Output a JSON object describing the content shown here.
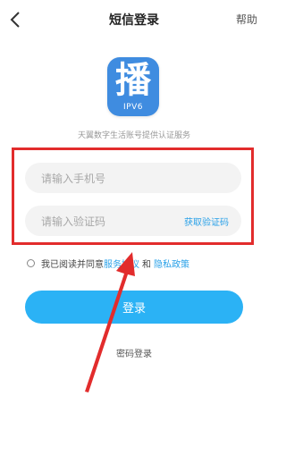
{
  "header": {
    "back_icon": "chevron-left-icon",
    "title": "短信登录",
    "help_label": "帮助"
  },
  "logo": {
    "glyph": "播",
    "tag": "IPV6",
    "color": "#3f8ce0"
  },
  "subtitle": "天翼数字生活账号提供认证服务",
  "form": {
    "phone_placeholder": "请输入手机号",
    "code_placeholder": "请输入验证码",
    "get_code_label": "获取验证码"
  },
  "agreement": {
    "prefix": "我已阅读并同意",
    "service_link": "服务协议",
    "and": "和",
    "privacy_link": "隐私政策"
  },
  "login_button": "登录",
  "password_login": "密码登录",
  "annotation": {
    "highlight_color": "#e22c2c",
    "arrow_icon": "red-arrow-icon"
  },
  "colors": {
    "accent": "#2bb2f5",
    "link": "#2aa1e8"
  }
}
